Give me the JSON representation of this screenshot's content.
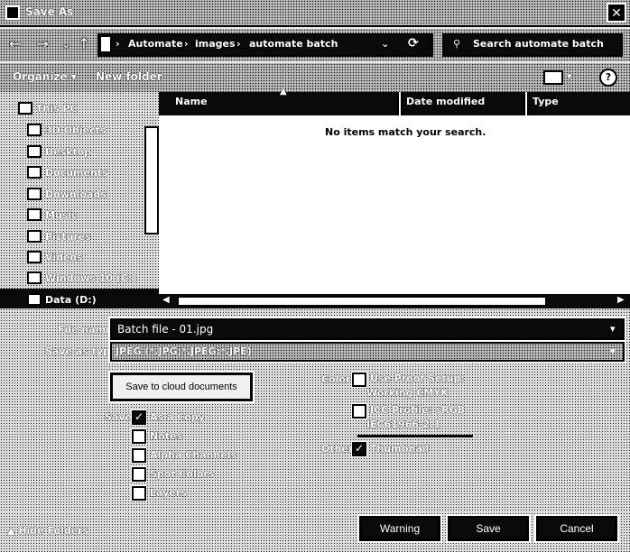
{
  "window": {
    "title": "Save As",
    "close_glyph": "✕"
  },
  "nav": {
    "back_glyph": "←",
    "forward_glyph": "→",
    "recent_glyph": "⌄",
    "up_glyph": "↑",
    "crumbs": [
      "Automate",
      "images",
      "automate batch"
    ],
    "crumb_sep": "›",
    "refresh_glyph": "⟳",
    "search_placeholder": "Search automate batch"
  },
  "toolbar": {
    "organize_label": "Organize",
    "new_folder_label": "New folder",
    "help_glyph": "?"
  },
  "tree": {
    "items": [
      {
        "label": "This PC",
        "icon": "computer-icon"
      },
      {
        "label": "3D Objects",
        "icon": "cube-icon"
      },
      {
        "label": "Desktop",
        "icon": "desktop-icon"
      },
      {
        "label": "Documents",
        "icon": "document-icon"
      },
      {
        "label": "Downloads",
        "icon": "download-icon"
      },
      {
        "label": "Music",
        "icon": "music-icon"
      },
      {
        "label": "Pictures",
        "icon": "picture-icon"
      },
      {
        "label": "Videos",
        "icon": "video-icon"
      },
      {
        "label": "Windows 10 (C:)",
        "icon": "drive-icon"
      },
      {
        "label": "Data (D:)",
        "icon": "drive-icon"
      }
    ]
  },
  "filelist": {
    "columns": [
      "Name",
      "Date modified",
      "Type"
    ],
    "empty_message": "No items match your search."
  },
  "form": {
    "filename_label": "File name:",
    "filename_value": "Batch file - 01.jpg",
    "savetype_label": "Save as type:",
    "savetype_value": "JPEG (*.JPG;*.JPEG;*.JPE)"
  },
  "options": {
    "cloud_button": "Save to cloud documents",
    "save_label": "Save:",
    "save_items": [
      {
        "label": "As a Copy",
        "checked": true
      },
      {
        "label": "Notes",
        "checked": false
      },
      {
        "label": "Alpha Channels",
        "checked": false
      },
      {
        "label": "Spot Colors",
        "checked": false
      },
      {
        "label": "Layers",
        "checked": false
      }
    ],
    "color_label": "Color:",
    "color_items": [
      {
        "label": "Use Proof Setup:",
        "sub": "Working CMYK",
        "checked": false
      },
      {
        "label": "ICC Profile: sRGB",
        "sub": "IEC61966-2.1",
        "checked": false
      }
    ],
    "other_label": "Other:",
    "other_items": [
      {
        "label": "Thumbnail",
        "checked": true
      }
    ]
  },
  "footer": {
    "hide_folders": "Hide Folders",
    "warning": "Warning",
    "save": "Save",
    "cancel": "Cancel"
  }
}
